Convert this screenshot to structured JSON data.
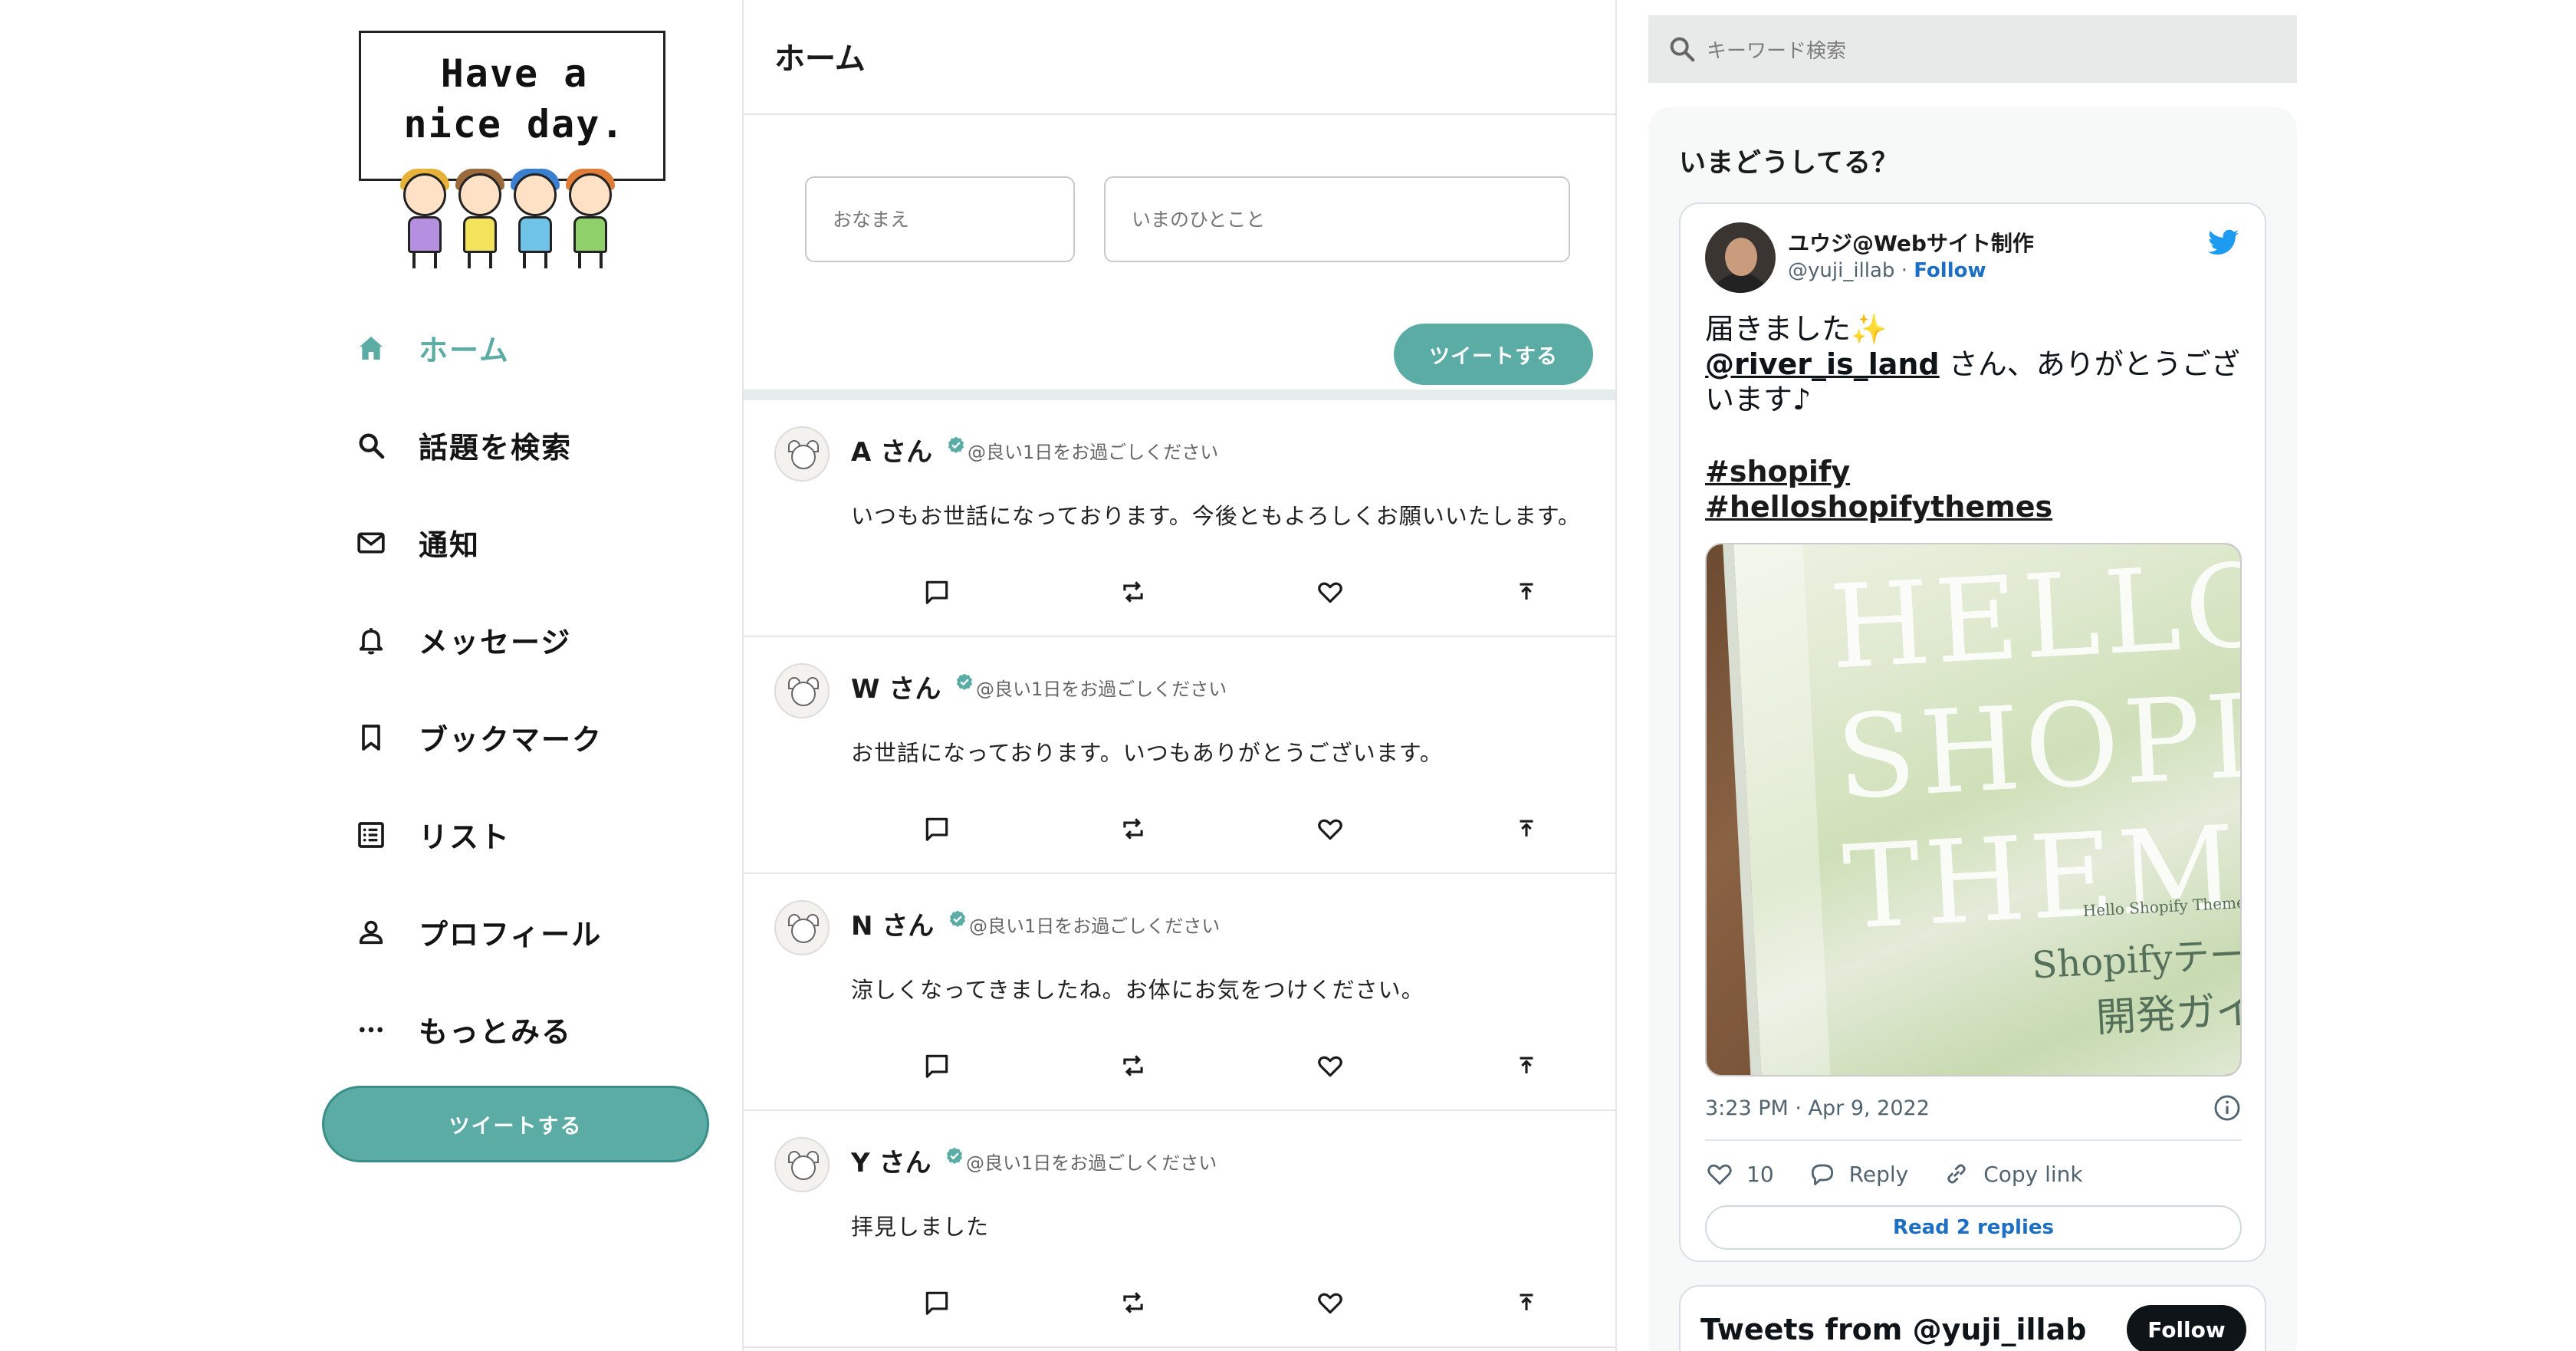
{
  "logo": {
    "line1": "Have a",
    "line2": "nice day."
  },
  "nav": {
    "items": [
      {
        "label": "ホーム",
        "icon": "home-icon",
        "active": true
      },
      {
        "label": "話題を検索",
        "icon": "search-icon"
      },
      {
        "label": "通知",
        "icon": "mail-icon"
      },
      {
        "label": "メッセージ",
        "icon": "bell-icon"
      },
      {
        "label": "ブックマーク",
        "icon": "bookmark-icon"
      },
      {
        "label": "リスト",
        "icon": "list-icon"
      },
      {
        "label": "プロフィール",
        "icon": "person-icon"
      },
      {
        "label": "もっとみる",
        "icon": "more-icon"
      }
    ],
    "tweet_button": "ツイートする"
  },
  "feed": {
    "title": "ホーム",
    "compose": {
      "name_placeholder": "おなまえ",
      "message_placeholder": "いまのひとこと",
      "submit": "ツイートする"
    },
    "posts": [
      {
        "name": "A さん",
        "handle": "@良い1日をお過ごしください",
        "text": "いつもお世話になっております。今後ともよろしくお願いいたします。"
      },
      {
        "name": "W さん",
        "handle": "@良い1日をお過ごしください",
        "text": "お世話になっております。いつもありがとうございます。"
      },
      {
        "name": "N さん",
        "handle": "@良い1日をお過ごしください",
        "text": "涼しくなってきましたね。お体にお気をつけください。"
      },
      {
        "name": "Y さん",
        "handle": "@良い1日をお過ごしください",
        "text": "拝見しました"
      }
    ]
  },
  "search": {
    "placeholder": "キーワード検索"
  },
  "widget": {
    "title": "いまどうしてる？",
    "embed": {
      "author": "ユウジ@Webサイト制作",
      "handle": "@yuji_illab",
      "separator": "·",
      "follow": "Follow",
      "line1": "届きました✨",
      "mention": "@river_is_land",
      "line2": " さん、ありがとうございます♪",
      "tag1": "#shopify",
      "tag2": "#helloshopifythemes",
      "image_text": {
        "big1": "HELLO",
        "big2": "SHOPIFY",
        "big3": "THEMES",
        "jp1": "Shopifyテーマ",
        "jp2": "開発ガイド",
        "small": "Hello Shopify Themes"
      },
      "time": "3:23 PM · Apr 9, 2022",
      "likes": "10",
      "reply": "Reply",
      "copy": "Copy link",
      "read_replies": "Read 2 replies"
    },
    "timeline": {
      "title": "Tweets from @yuji_illab",
      "follow": "Follow"
    }
  },
  "colors": {
    "accent": "#5caca6",
    "link": "#1d6fc3",
    "twitter": "#1d9bf0"
  }
}
